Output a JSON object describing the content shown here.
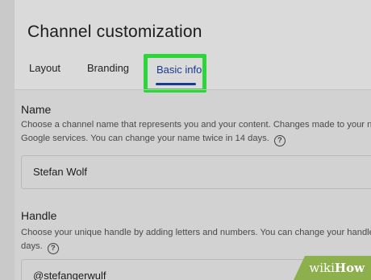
{
  "page_title": "Channel customization",
  "tabs": [
    {
      "label": "Layout"
    },
    {
      "label": "Branding"
    },
    {
      "label": "Basic info",
      "selected": true
    }
  ],
  "highlight_color": "#2bd53a",
  "accent_color": "#1a3a8f",
  "name_section": {
    "label": "Name",
    "desc_line1": "Choose a channel name that represents you and your content. Changes made to your nam",
    "desc_line2": "Google services. You can change your name twice in 14 days.",
    "value": "Stefan Wolf"
  },
  "handle_section": {
    "label": "Handle",
    "desc_line1": "Choose your unique handle by adding letters and numbers. You can change your handle ba",
    "desc_line2": "days.",
    "value": "@stefangerwulf"
  },
  "help_icon_glyph": "?",
  "watermark": {
    "wiki": "wiki",
    "how": "How"
  }
}
